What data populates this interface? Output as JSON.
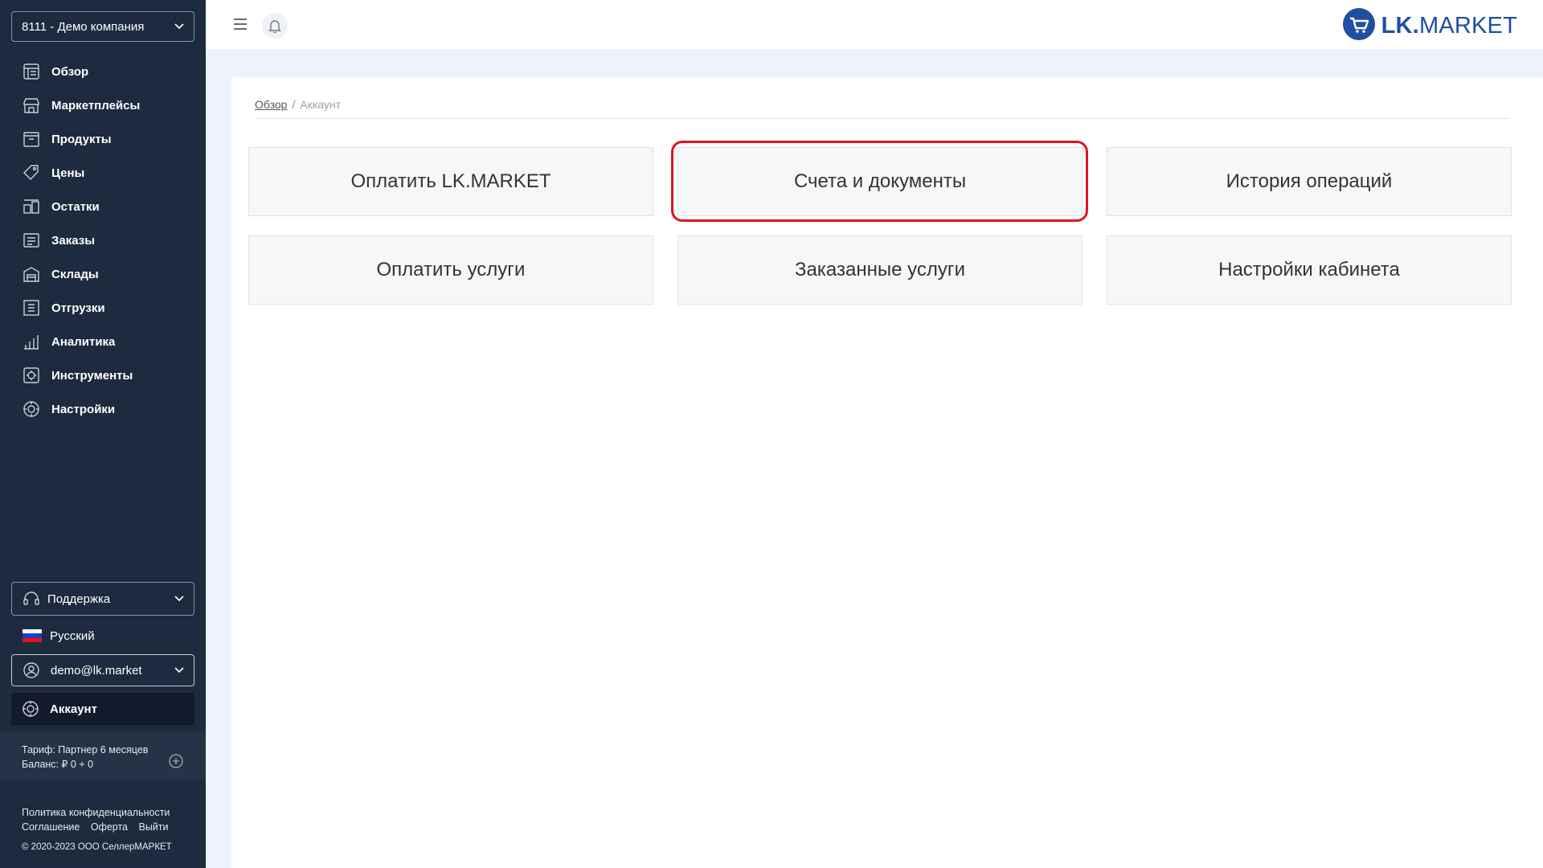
{
  "sidebar": {
    "company_select": "8111 - Демо компания",
    "nav": [
      {
        "label": "Обзор",
        "icon": "overview-icon"
      },
      {
        "label": "Маркетплейсы",
        "icon": "store-icon"
      },
      {
        "label": "Продукты",
        "icon": "box-icon"
      },
      {
        "label": "Цены",
        "icon": "price-tag-icon"
      },
      {
        "label": "Остатки",
        "icon": "stock-icon"
      },
      {
        "label": "Заказы",
        "icon": "orders-icon"
      },
      {
        "label": "Склады",
        "icon": "warehouse-icon"
      },
      {
        "label": "Отгрузки",
        "icon": "shipment-icon"
      },
      {
        "label": "Аналитика",
        "icon": "chart-icon"
      },
      {
        "label": "Инструменты",
        "icon": "tools-icon"
      },
      {
        "label": "Настройки",
        "icon": "settings-icon"
      }
    ],
    "support": "Поддержка",
    "language": "Русский",
    "user_email": "demo@lk.market",
    "account": "Аккаунт",
    "tariff": "Тариф: Партнер 6 месяцев",
    "balance": "Баланс: ₽ 0 + 0",
    "footer": {
      "privacy": "Политика конфиденциальности",
      "agreement": "Соглашение",
      "offer": "Оферта",
      "logout": "Выйти",
      "copyright": "© 2020-2023 ООО СеллерМАРКЕТ"
    }
  },
  "header": {
    "logo_bold": "LK.",
    "logo_rest": "MARKET"
  },
  "breadcrumb": {
    "home": "Обзор",
    "separator": "/",
    "current": "Аккаунт"
  },
  "tiles": [
    "Оплатить LK.MARKET",
    "Счета и документы",
    "История операций",
    "Оплатить услуги",
    "Заказанные услуги",
    "Настройки кабинета"
  ],
  "colors": {
    "sidebar_bg": "#1e2a3e",
    "accent": "#1f4fa0",
    "highlight": "#e0141e"
  }
}
